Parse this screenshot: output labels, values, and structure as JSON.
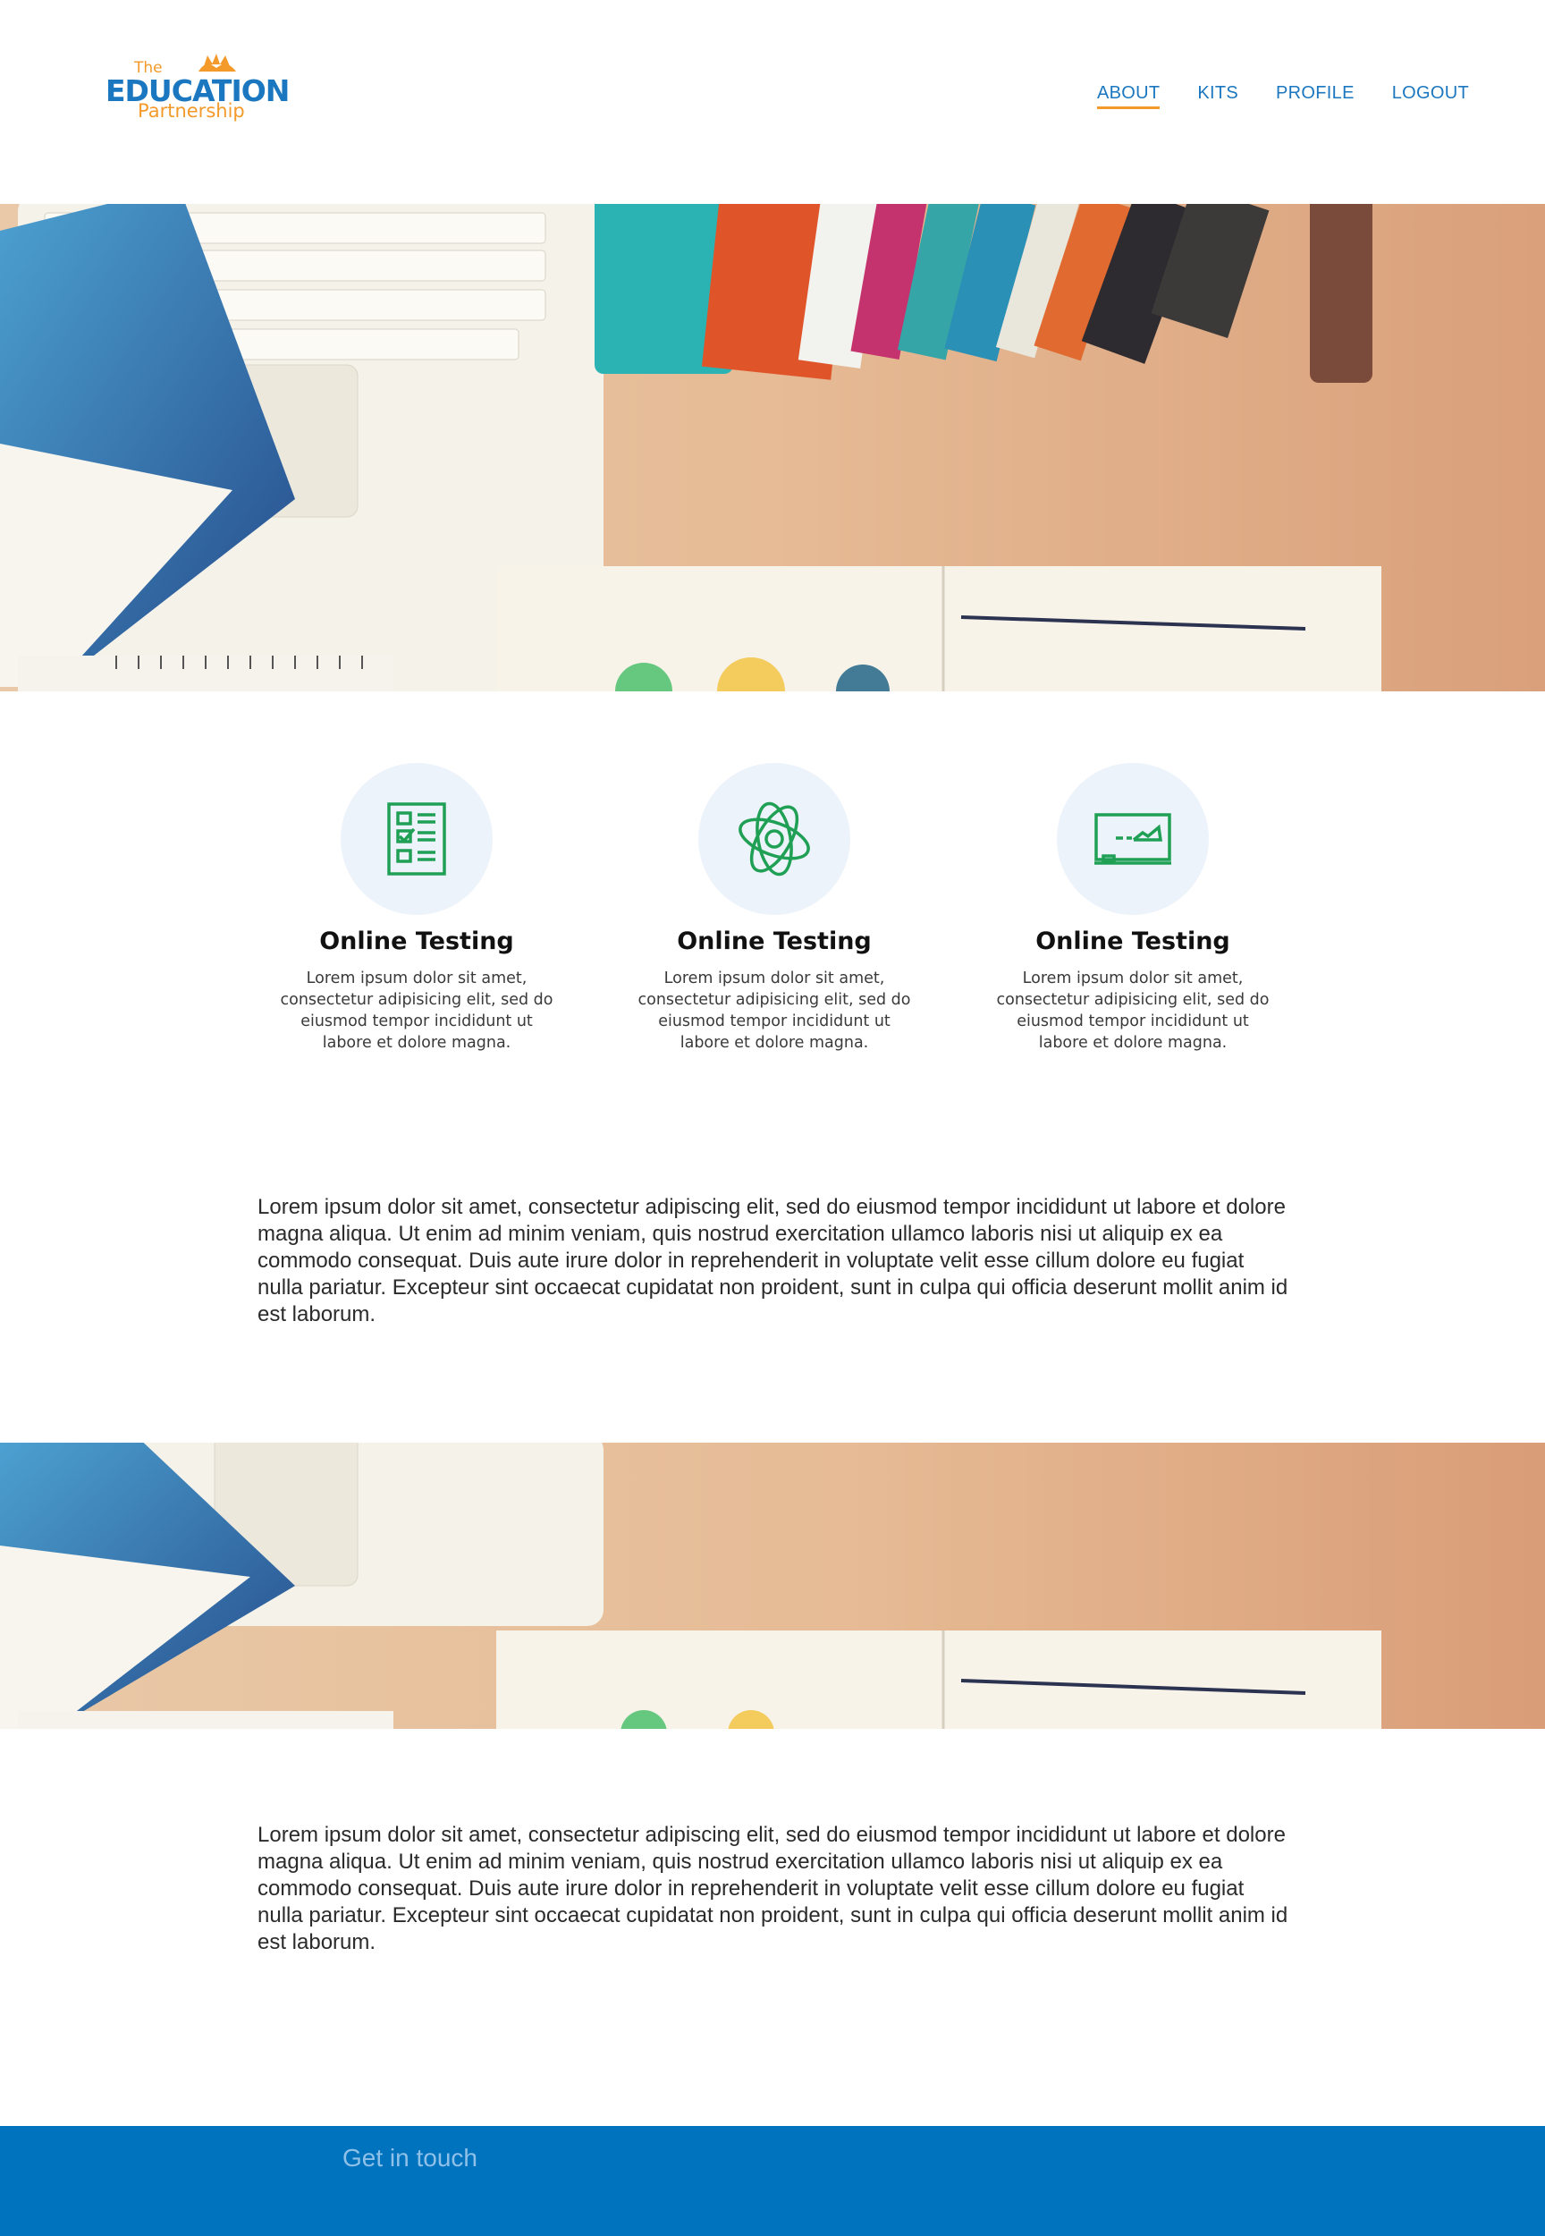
{
  "header": {
    "logo": {
      "line1": "The",
      "line2": "EDUCATION",
      "line3": "Partnership"
    },
    "nav": [
      {
        "label": "ABOUT"
      },
      {
        "label": "KITS"
      },
      {
        "label": "PROFILE"
      },
      {
        "label": "LOGOUT"
      }
    ]
  },
  "features": [
    {
      "icon": "checklist-icon",
      "title": "Online Testing",
      "text": "Lorem ipsum dolor sit amet, consectetur adipisicing elit, sed do eiusmod tempor incididunt ut labore et dolore magna."
    },
    {
      "icon": "atom-icon",
      "title": "Online Testing",
      "text": "Lorem ipsum dolor sit amet, consectetur adipisicing elit, sed do eiusmod tempor incididunt ut labore et dolore magna."
    },
    {
      "icon": "whiteboard-icon",
      "title": "Online Testing",
      "text": "Lorem ipsum dolor sit amet, consectetur adipisicing elit, sed do eiusmod tempor incididunt ut labore et dolore magna."
    }
  ],
  "paragraphs": [
    "Lorem ipsum dolor sit amet, consectetur adipiscing elit, sed do eiusmod tempor incididunt ut labore et dolore magna aliqua. Ut enim ad minim veniam, quis nostrud exercitation ullamco laboris nisi ut aliquip ex ea commodo consequat. Duis aute irure dolor in reprehenderit in voluptate velit esse cillum dolore eu fugiat nulla pariatur. Excepteur sint occaecat cupidatat non proident, sunt in culpa qui officia deserunt mollit anim id est laborum.",
    "Lorem ipsum dolor sit amet, consectetur adipiscing elit, sed do eiusmod tempor incididunt ut labore et dolore magna aliqua. Ut enim ad minim veniam, quis nostrud exercitation ullamco laboris nisi ut aliquip ex ea commodo consequat. Duis aute irure dolor in reprehenderit in voluptate velit esse cillum dolore eu fugiat nulla pariatur. Excepteur sint occaecat cupidatat non proident, sunt in culpa qui officia deserunt mollit anim id est laborum."
  ],
  "footer": {
    "title": "Get in touch"
  },
  "colors": {
    "brand_blue": "#1b77bf",
    "brand_orange": "#f39a2b",
    "icon_green": "#1fa055",
    "footer_blue": "#0073bf",
    "icon_circle": "#edf3fa"
  }
}
